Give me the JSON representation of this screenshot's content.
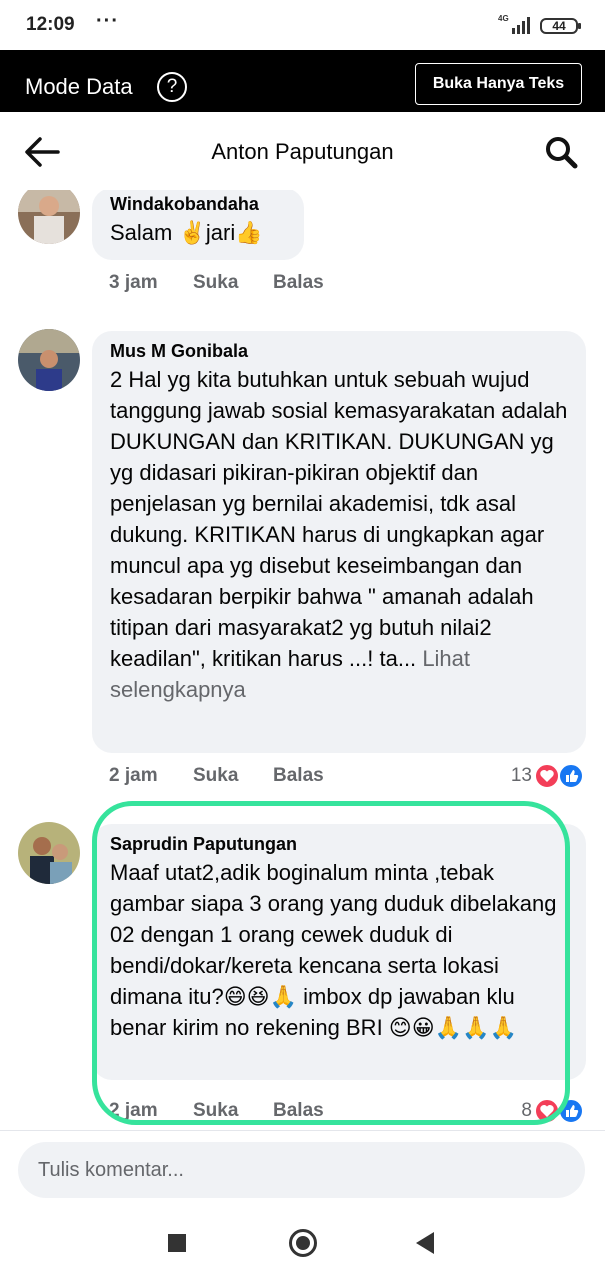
{
  "status_bar": {
    "time": "12:09",
    "dots": "···",
    "network": "4G",
    "battery": "44"
  },
  "data_mode": {
    "title": "Mode Data",
    "help_icon": "question-circle-icon",
    "text_only_button": "Buka Hanya Teks"
  },
  "header": {
    "title": "Anton Paputungan",
    "back_icon": "arrow-left-icon",
    "search_icon": "search-icon"
  },
  "comments": [
    {
      "author": "Windakobandaha",
      "text": "Salam ✌️jari👍",
      "time": "3 jam",
      "like": "Suka",
      "reply": "Balas"
    },
    {
      "author": "Mus M Gonibala",
      "text": "2 Hal yg kita butuhkan untuk sebuah wujud tanggung jawab sosial kemasyarakatan adalah DUKUNGAN dan KRITIKAN. DUKUNGAN yg yg didasari pikiran-pikiran objektif dan penjelasan yg bernilai akademisi, tdk asal dukung. KRITIKAN harus di ungkapkan agar muncul apa yg disebut keseimbangan dan kesadaran berpikir bahwa \" amanah adalah titipan dari masyarakat2 yg butuh nilai2 keadilan\", kritikan harus ...! ta...",
      "see_more": "Lihat selengkapnya",
      "time": "2 jam",
      "like": "Suka",
      "reply": "Balas",
      "reaction_count": "13"
    },
    {
      "author": "Saprudin Paputungan",
      "text": "Maaf utat2,adik boginalum minta ,tebak gambar siapa 3 orang yang duduk dibelakang 02 dengan 1 orang cewek duduk di bendi/dokar/kereta kencana serta lokasi dimana itu?😄😆🙏 imbox dp jawaban klu benar kirim no rekening BRI 😊😀🙏🙏🙏",
      "time": "2 jam",
      "like": "Suka",
      "reply": "Balas",
      "reaction_count": "8"
    }
  ],
  "compose": {
    "placeholder": "Tulis komentar..."
  },
  "colors": {
    "accent_highlight": "#36e39c",
    "like_blue": "#1877f2",
    "love_red": "#f33e58",
    "bubble_bg": "#f0f2f5"
  }
}
